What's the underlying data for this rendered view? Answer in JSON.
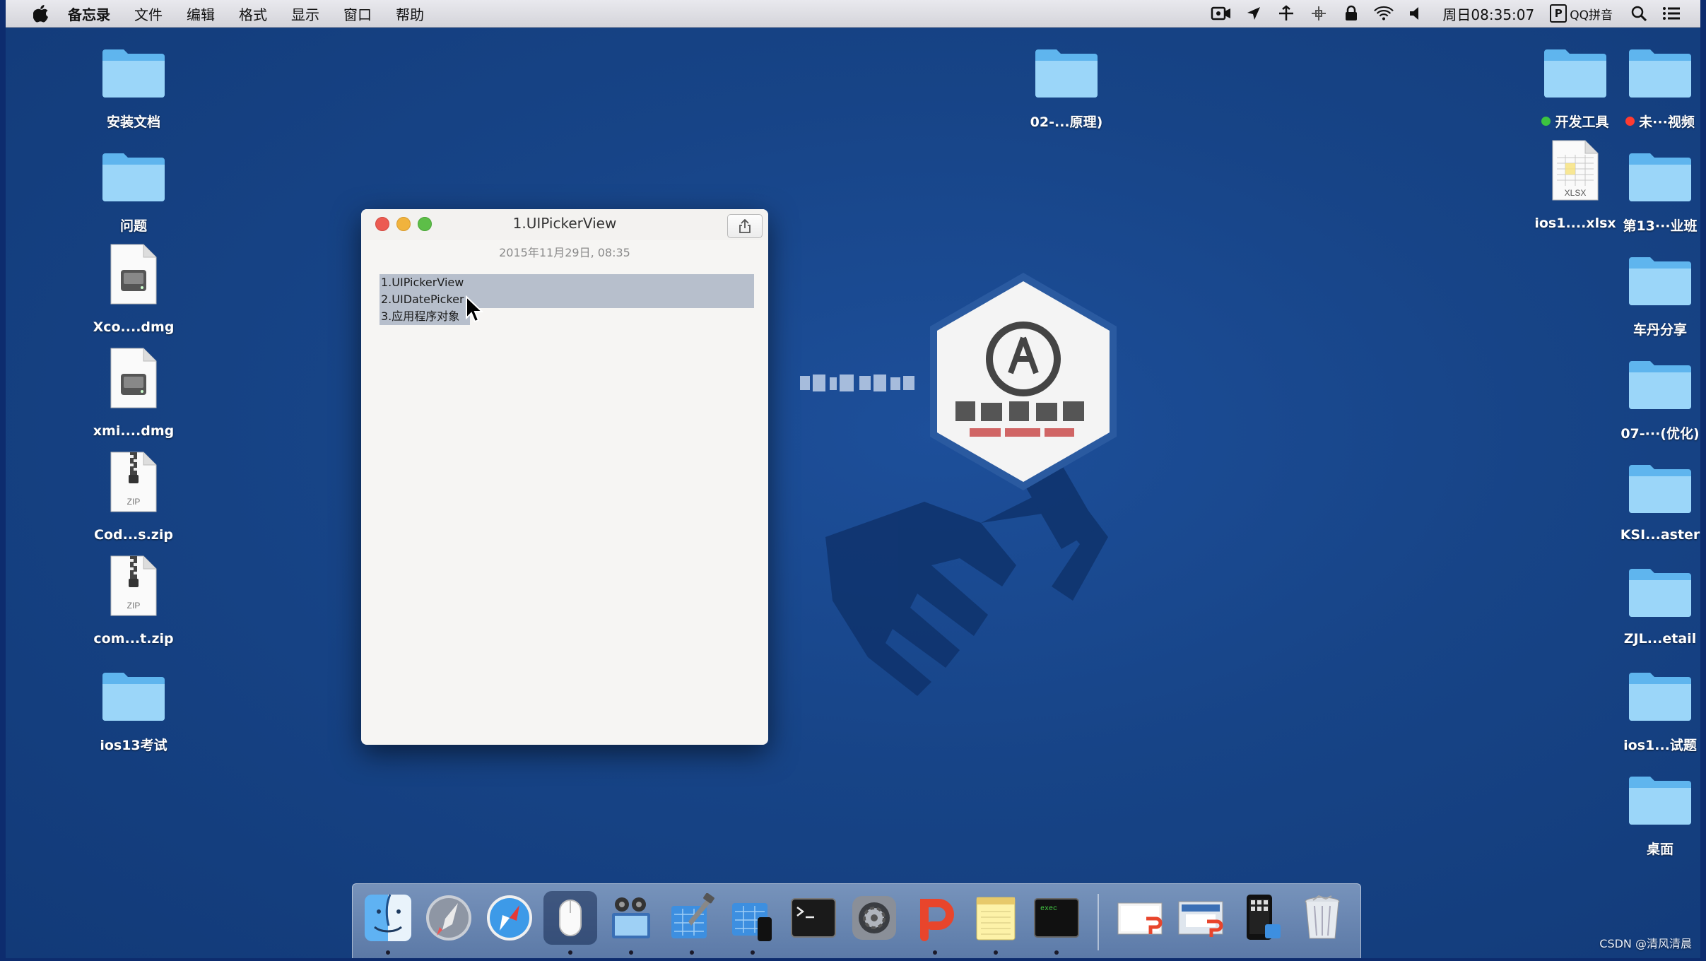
{
  "menubar": {
    "app_name": "备忘录",
    "items": [
      "文件",
      "编辑",
      "格式",
      "显示",
      "窗口",
      "帮助"
    ],
    "clock": "周日08:35:07",
    "input_method": "QQ拼音",
    "input_method_letter": "P"
  },
  "desktop": {
    "left_column": [
      {
        "label": "安装文档",
        "type": "folder"
      },
      {
        "label": "问题",
        "type": "folder"
      },
      {
        "label": "Xco....dmg",
        "type": "dmg"
      },
      {
        "label": "xmi....dmg",
        "type": "dmg"
      },
      {
        "label": "Cod...s.zip",
        "type": "zip"
      },
      {
        "label": "com...t.zip",
        "type": "zip"
      },
      {
        "label": "ios13考试",
        "type": "folder"
      }
    ],
    "center_folder": {
      "label": "02-...原理)",
      "type": "folder"
    },
    "right_col_a": [
      {
        "label": "开发工具",
        "type": "folder",
        "tag_color": "#3cc440"
      },
      {
        "label": "ios1....xlsx",
        "type": "xlsx"
      }
    ],
    "right_col_b": [
      {
        "label": "未···视频",
        "type": "folder",
        "tag_color": "#ff3b30"
      },
      {
        "label": "第13···业班",
        "type": "folder"
      },
      {
        "label": "车丹分享",
        "type": "folder"
      },
      {
        "label": "07-···(优化)",
        "type": "folder"
      },
      {
        "label": "KSI...aster",
        "type": "folder"
      },
      {
        "label": "ZJL...etail",
        "type": "folder"
      },
      {
        "label": "ios1...试题",
        "type": "folder"
      },
      {
        "label": "桌面",
        "type": "folder"
      }
    ],
    "file_badges": {
      "zip": "ZIP",
      "xlsx": "XLSX"
    }
  },
  "notes_window": {
    "title": "1.UIPickerView",
    "date": "2015年11月29日, 08:35",
    "lines": [
      "1.UIPickerView",
      "2.UIDatePicker",
      "3.应用程序对象"
    ]
  },
  "dock": {
    "items": [
      {
        "name": "finder-icon",
        "running": true
      },
      {
        "name": "launchpad-icon",
        "running": false
      },
      {
        "name": "safari-icon",
        "running": false
      },
      {
        "name": "mouse-app-icon",
        "running": true
      },
      {
        "name": "photo-booth-icon",
        "running": true
      },
      {
        "name": "xcode-icon",
        "running": true
      },
      {
        "name": "xcode-simulator-icon",
        "running": true
      },
      {
        "name": "terminal-icon",
        "running": false
      },
      {
        "name": "system-preferences-icon",
        "running": false
      },
      {
        "name": "wps-presentation-icon",
        "running": true
      },
      {
        "name": "notes-icon",
        "running": true
      },
      {
        "name": "exec-icon",
        "running": true
      },
      {
        "name": "preview-document-icon",
        "running": false
      },
      {
        "name": "screen-recorder-icon",
        "running": false
      },
      {
        "name": "simulator-device-icon",
        "running": false
      },
      {
        "name": "trash-icon",
        "running": false
      }
    ]
  },
  "exec_label": "exec",
  "watermark": "CSDN @清风清晨",
  "colors": {
    "desktop": "#174487",
    "folder_light": "#8fd0f7",
    "folder_dark": "#4fa9e8",
    "selection": "#b7bfcc"
  }
}
